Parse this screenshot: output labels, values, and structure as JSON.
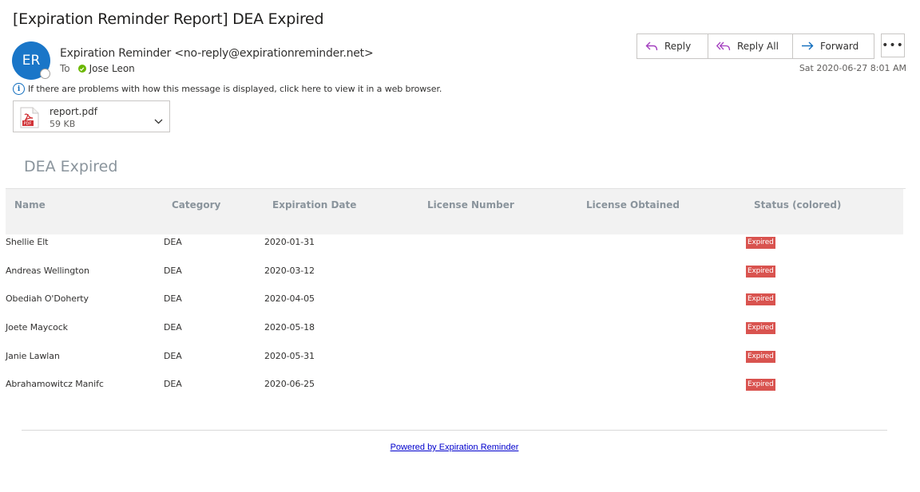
{
  "email": {
    "subject": "[Expiration Reminder Report] DEA Expired",
    "avatar_initials": "ER",
    "sender": "Expiration Reminder <no-reply@expirationreminder.net>",
    "to_label": "To",
    "recipient": "Jose Leon",
    "info_text": "If there are problems with how this message is displayed, click here to view it in a web browser.",
    "date": "Sat 2020-06-27 8:01 AM",
    "attachment": {
      "name": "report.pdf",
      "size": "59 KB"
    }
  },
  "actions": {
    "reply": "Reply",
    "reply_all": "Reply All",
    "forward": "Forward",
    "more": "•••"
  },
  "report": {
    "title": "DEA Expired",
    "columns": [
      "Name",
      "Category",
      "Expiration Date",
      "License Number",
      "License Obtained",
      "Status (colored)"
    ],
    "rows": [
      {
        "name": "Shellie Elt",
        "category": "DEA",
        "expiration_date": "2020-01-31",
        "license_number": "",
        "license_obtained": "",
        "status": "Expired"
      },
      {
        "name": "Andreas Wellington",
        "category": "DEA",
        "expiration_date": "2020-03-12",
        "license_number": "",
        "license_obtained": "",
        "status": "Expired"
      },
      {
        "name": "Obediah O'Doherty",
        "category": "DEA",
        "expiration_date": "2020-04-05",
        "license_number": "",
        "license_obtained": "",
        "status": "Expired"
      },
      {
        "name": "Joete Maycock",
        "category": "DEA",
        "expiration_date": "2020-05-18",
        "license_number": "",
        "license_obtained": "",
        "status": "Expired"
      },
      {
        "name": "Janie Lawlan",
        "category": "DEA",
        "expiration_date": "2020-05-31",
        "license_number": "",
        "license_obtained": "",
        "status": "Expired"
      },
      {
        "name": "Abrahamowitcz Manifc",
        "category": "DEA",
        "expiration_date": "2020-06-25",
        "license_number": "",
        "license_obtained": "",
        "status": "Expired"
      }
    ],
    "footer_link": "Powered by Expiration Reminder"
  },
  "colors": {
    "avatar": "#1a76c8",
    "status_expired": "#d9534f",
    "presence_available": "#6bb700",
    "action_icon": "#a33fbf",
    "forward_icon": "#0f6cbd"
  }
}
